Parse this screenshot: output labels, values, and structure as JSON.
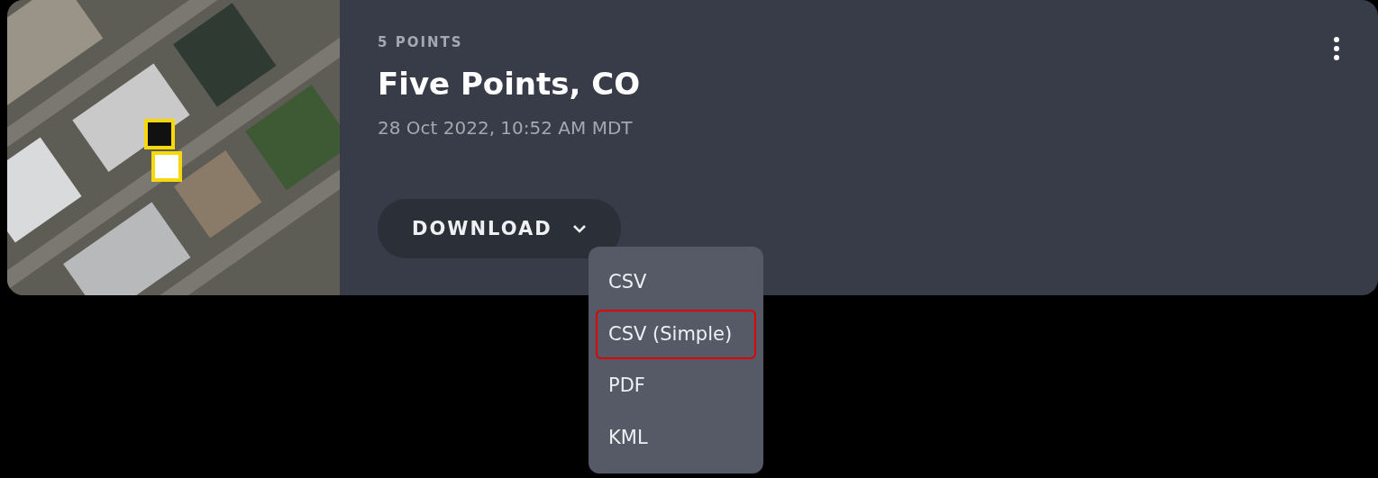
{
  "card": {
    "count_label": "5 POINTS",
    "title": "Five Points, CO",
    "timestamp": "28 Oct 2022, 10:52 AM MDT",
    "download_button": {
      "label": "DOWNLOAD",
      "expanded": true
    }
  },
  "download_menu": [
    {
      "label": "CSV",
      "highlighted": false
    },
    {
      "label": "CSV (Simple)",
      "highlighted": true
    },
    {
      "label": "PDF",
      "highlighted": false
    },
    {
      "label": "KML",
      "highlighted": false
    }
  ]
}
